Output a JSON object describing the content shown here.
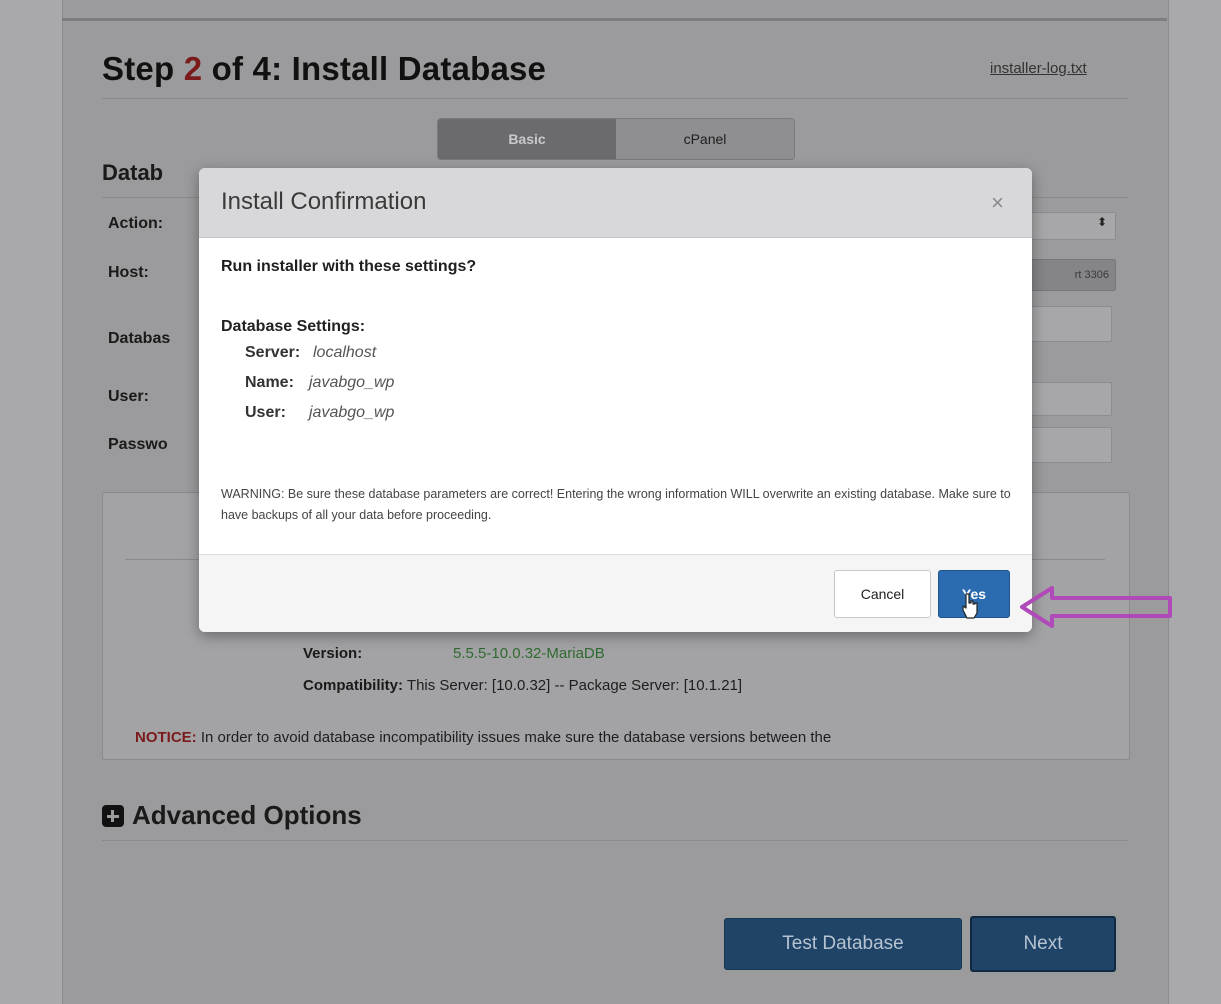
{
  "page": {
    "title_prefix": "Step ",
    "title_step": "2",
    "title_suffix": " of 4: Install Database",
    "log_link": "installer-log.txt"
  },
  "mode_toggle": {
    "basic": "Basic",
    "cpanel": "cPanel"
  },
  "database_setup": {
    "heading": "Datab",
    "labels": {
      "action": "Action:",
      "host": "Host:",
      "database": "Databas",
      "user": "User:",
      "password": "Passwo"
    },
    "port": "rt 3306"
  },
  "server_info": {
    "version_label": "Version:",
    "version_value": "5.5.5-10.0.32-MariaDB",
    "compat_label": "Compatibility:",
    "compat_value": "This Server: [10.0.32] -- Package Server: [10.1.21]",
    "notice_label": "NOTICE:",
    "notice_text": "In order to avoid database incompatibility issues make sure the database versions between the"
  },
  "advanced_options": "Advanced Options",
  "buttons": {
    "test_database": "Test Database",
    "next": "Next"
  },
  "modal": {
    "title": "Install Confirmation",
    "close": "×",
    "question": "Run installer with these settings?",
    "settings_heading": "Database Settings:",
    "rows": [
      {
        "key": "Server:",
        "value": "localhost"
      },
      {
        "key": "Name:",
        "value": "javabgo_wp"
      },
      {
        "key": "User:",
        "value": "javabgo_wp"
      }
    ],
    "warning": "WARNING: Be sure these database parameters are correct! Entering the wrong information WILL overwrite an existing database. Make sure to have backups of all your data before proceeding.",
    "cancel": "Cancel",
    "yes": "Yes"
  },
  "colors": {
    "accent_blue": "#2b6cb0",
    "dark_button": "#1f4468",
    "annotation_arrow": "#b04ab8",
    "step_red": "#7b1a1a"
  }
}
